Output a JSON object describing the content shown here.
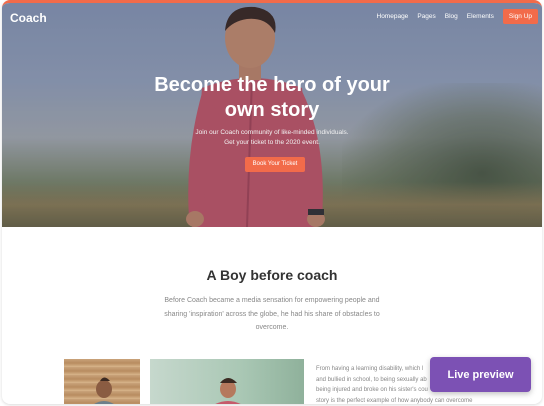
{
  "nav": {
    "logo": "Coach",
    "links": [
      "Homepage",
      "Pages",
      "Blog",
      "Elements"
    ],
    "signup_label": "Sign Up"
  },
  "hero": {
    "title_line1": "Become the hero of your",
    "title_line2": "own story",
    "subtitle_line1": "Join our Coach community of like-minded individuals.",
    "subtitle_line2": "Get your ticket to the 2020 event.",
    "cta_label": "Book Your Ticket"
  },
  "about": {
    "title": "A Boy before coach",
    "text": "Before Coach became a media sensation for empowering people and sharing 'inspiration' across the globe, he had his share of obstacles to overcome.",
    "story_lines": [
      "From having a learning disability, which l",
      "and bullied in school, to being sexually ab",
      "being injured and broke on his sister's cou",
      "story is the perfect example of how anybody can overcome"
    ]
  },
  "live_preview_label": "Live preview",
  "colors": {
    "accent": "#f26b4a",
    "preview_button": "#7c51b4"
  }
}
